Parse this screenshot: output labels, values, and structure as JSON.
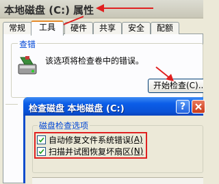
{
  "properties_window": {
    "title": "本地磁盘 (C:) 属性",
    "tabs": [
      {
        "label": "常规",
        "active": false
      },
      {
        "label": "工具",
        "active": true
      },
      {
        "label": "硬件",
        "active": false
      },
      {
        "label": "共享",
        "active": false
      },
      {
        "label": "安全",
        "active": false
      },
      {
        "label": "配额",
        "active": false
      }
    ],
    "error_check": {
      "group_label": "查错",
      "description": "该选项将检查卷中的错误。",
      "button_label": "开始检查(C)...",
      "icon": "disk-check-icon"
    }
  },
  "check_dialog": {
    "title": "检查磁盘 本地磁盘 (C:)",
    "help_label": "?",
    "options_group_label": "磁盘检查选项",
    "options": [
      {
        "label": "自动修复文件系统错误",
        "shortcut": "(A)",
        "checked": true
      },
      {
        "label": "扫描并试图恢复坏扇区",
        "shortcut": "(N)",
        "checked": true
      }
    ]
  },
  "annotation": {
    "color": "#e02020"
  }
}
